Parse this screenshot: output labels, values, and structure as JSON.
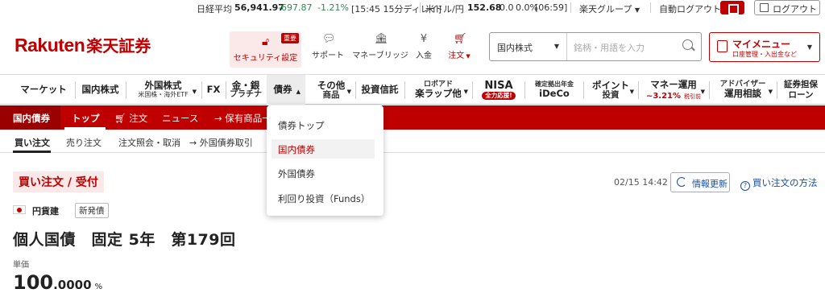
{
  "ticker": {
    "nikkei_label": "日経平均",
    "nikkei_value": "56,941.97",
    "nikkei_change": "-697.87",
    "nikkei_pct": "-1.21%",
    "nikkei_time": "[15:45 15分ディレイ]",
    "usdjpy_label": "米ドル/円",
    "usdjpy_value": "152.68",
    "usdjpy_change": "0.0",
    "usdjpy_pct": "0.0%",
    "usdjpy_time": "[06:59]",
    "group": "楽天グループ",
    "auto_logout": "自動ログアウト",
    "logout": "ログアウト"
  },
  "header": {
    "logo_en": "Rakuten",
    "logo_jp": "楽天証券",
    "security_label": "セキュリティ設定",
    "security_badge": "重要",
    "support": "サポート",
    "money_bridge": "マネーブリッジ",
    "deposit": "入金",
    "order": "注文",
    "search_select": "国内株式",
    "search_placeholder": "銘柄・用語を入力",
    "mymenu_title": "マイメニュー",
    "mymenu_sub": "口座管理・入出金など"
  },
  "mainnav": {
    "market": "マーケット",
    "domestic_stock": "国内株式",
    "foreign_stock": "外国株式",
    "foreign_stock_sub": "米国株・海外ETF",
    "fx": "FX",
    "gold": "金・銀",
    "gold_sub": "プラチナ",
    "bond": "債券",
    "other": "その他",
    "other_sub": "商品",
    "fund": "投資信託",
    "roboad": "ロボアド",
    "roboad_sub": "楽ラップ他",
    "nisa": "NISA",
    "nisa_badge": "全力応援!",
    "ideco_top": "確定拠出年金",
    "ideco": "iDeCo",
    "point": "ポイント",
    "point_sub": "投資",
    "money_mgmt": "マネー運用",
    "money_rate": "~3.21%",
    "money_rate_sub": "税引前",
    "advisor": "アドバイザー",
    "advisor_sub": "運用相談",
    "loan": "証券担保",
    "loan_sub": "ローン"
  },
  "subnav": {
    "category": "国内債券",
    "top": "トップ",
    "order": "注文",
    "news": "ニュース",
    "holdings": "保有商品一"
  },
  "ordertabs": {
    "buy": "買い注文",
    "sell": "売り注文",
    "inquiry": "注文照会・取消",
    "foreign_link": "外国債券取引"
  },
  "dropdown": {
    "items": [
      "債券トップ",
      "国内債券",
      "外国債券",
      "利回り投資（Funds）"
    ]
  },
  "content": {
    "title": "買い注文 / 受付",
    "timestamp": "02/15 14:42",
    "refresh": "情報更新",
    "howto": "買い注文の方法",
    "currency": "円貨建",
    "new_tag": "新発債",
    "bond_name": "個人国債　固定 5年　第179回",
    "price_label": "単価",
    "price_int": "100",
    "price_dec": ".0000",
    "price_unit": "%"
  },
  "colors": {
    "brand": "#bf0000",
    "link": "#1a4f9c",
    "negative": "#2e8b57"
  }
}
